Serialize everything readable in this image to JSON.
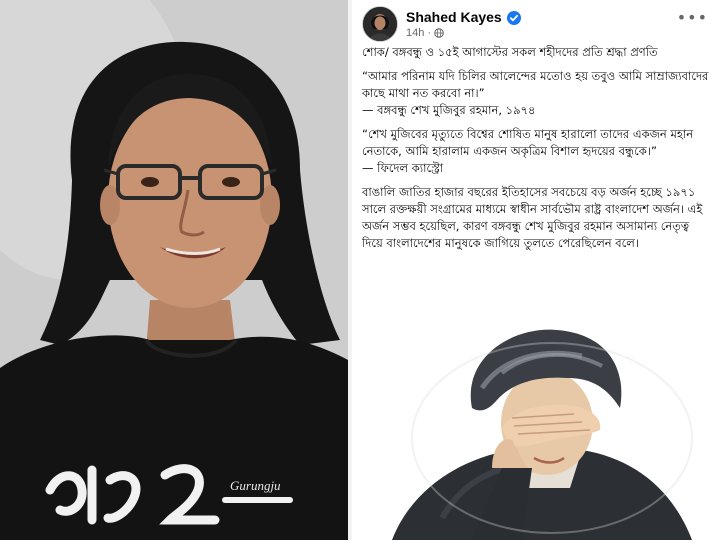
{
  "photo": {
    "shirt_text": "Gurungju",
    "shirt_graphic": "৮৮২"
  },
  "post": {
    "author": "Shahed Kayes",
    "time": "14h",
    "icons": {
      "verified": "verified-badge-icon",
      "audience": "globe-icon",
      "more": "more-options-icon"
    },
    "paragraphs": [
      "শোক/ বঙ্গবন্ধু ও ১৫ই আগাস্টের সকল শহীদদের প্রতি শ্রদ্ধা প্রণতি",
      "“আমার পরিনাম যদি চিলির আলেন্দের মতোও হয় তবুও আমি সাম্রাজ্যবাদের কাছে মাথা নত করবো না।”",
      "— বঙ্গবন্ধু শেখ মুজিবুর রহমান, ১৯৭৪",
      "“শেখ মুজিবের মৃত্যুতে বিশ্বের শোষিত মানুষ হারালো তাদের একজন মহান নেতাকে, আমি হারালাম একজন অকৃত্রিম বিশাল হৃদয়ের বন্ধুকে।”",
      "— ফিদেল ক্যাস্ট্রো",
      "বাঙালি জাতির হাজার বছরের ইতিহাসের সবচেয়ে বড় অর্জন হচ্ছে ১৯৭১ সালে রক্তক্ষয়ী সংগ্রামের মাধ্যমে স্বাধীন সার্বভৌম রাষ্ট্র বাংলাদেশ অর্জন। এই অর্জন সম্ভব হয়েছিল, কারণ বঙ্গবন্ধু শেখ মুজিবুর রহমান অসামান্য নেতৃত্ব দিয়ে বাংলাদেশের মানুষকে জাগিয়ে তুলতে পেরেছিলেন বলে।"
    ]
  }
}
